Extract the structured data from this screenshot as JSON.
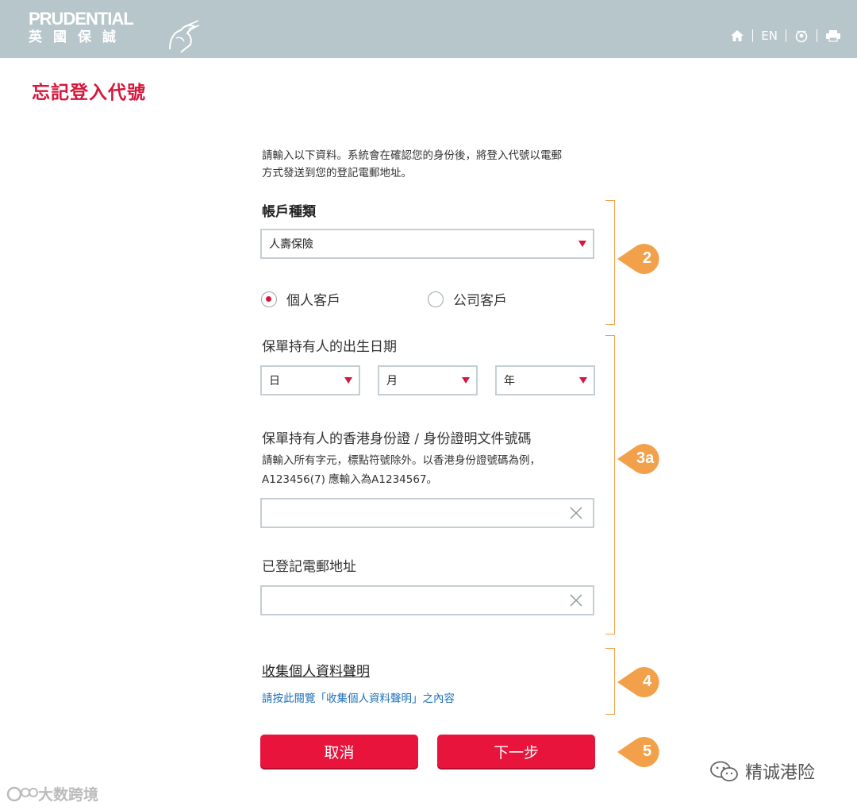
{
  "header": {
    "logo_en": "PRUDENTIAL",
    "logo_zh": "英國保誠",
    "lang_label": "EN",
    "icons": [
      "home-icon",
      "person-icon",
      "print-icon"
    ],
    "bg_color": "#b7c6ca"
  },
  "page": {
    "title": "忘記登入代號",
    "intro_line1": "請輸入以下資料。系統會在確認您的身份後，將登入代號以電郵",
    "intro_line2": "方式發送到您的登記電郵地址。",
    "accent_color": "#d6163a"
  },
  "account": {
    "label": "帳戶種類",
    "selected": "人壽保險",
    "radio_personal": "個人客戶",
    "radio_company": "公司客戶",
    "selected_radio": "個人客戶"
  },
  "dob": {
    "label": "保單持有人的出生日期",
    "day": "日",
    "month": "月",
    "year": "年"
  },
  "idcard": {
    "label": "保單持有人的香港身份證 / 身份證明文件號碼",
    "hint_line1": "請輸入所有字元，標點符號除外。以香港身份證號碼為例，",
    "hint_line2": "A123456(7) 應輸入為A1234567。",
    "value": ""
  },
  "email": {
    "label": "已登記電郵地址",
    "value": ""
  },
  "privacy": {
    "title": "收集個人資料聲明",
    "link": "請按此閱覽「收集個人資料聲明」之內容"
  },
  "buttons": {
    "cancel": "取消",
    "next": "下一步",
    "color": "#e8143c"
  },
  "annotations": {
    "markers": [
      "2",
      "3a",
      "4",
      "5"
    ],
    "color": "#f2a14a"
  },
  "watermarks": {
    "left": "大数跨境",
    "right": "精诚港险"
  }
}
